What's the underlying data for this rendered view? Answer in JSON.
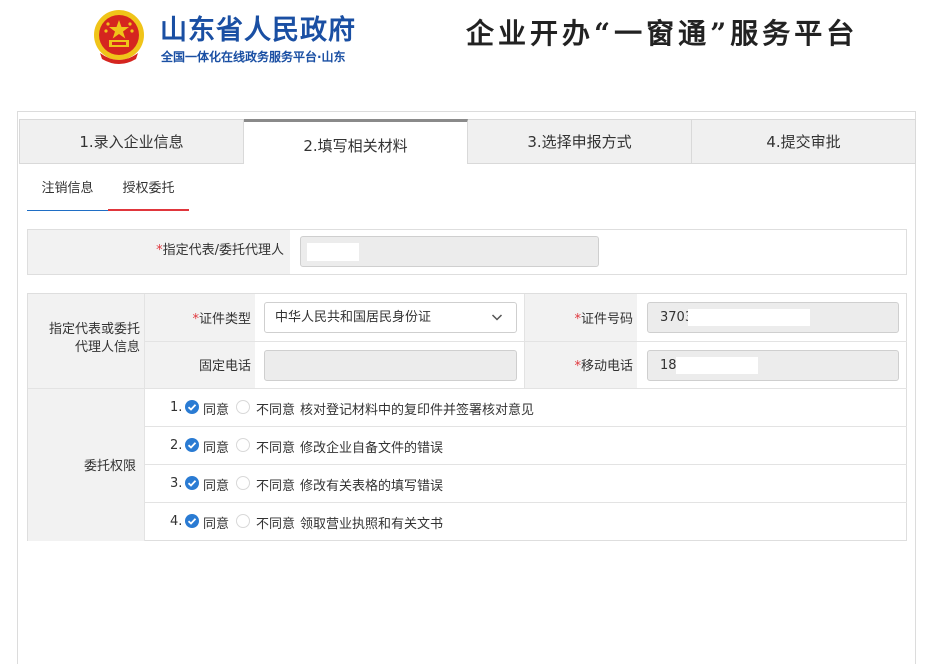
{
  "header": {
    "gov_name": "山东省人民政府",
    "gov_subtitle": "全国一体化在线政务服务平台·山东",
    "platform_title": "企业开办“一窗通”服务平台"
  },
  "steps": [
    {
      "label": "1.录入企业信息",
      "active": false
    },
    {
      "label": "2.填写相关材料",
      "active": true
    },
    {
      "label": "3.选择申报方式",
      "active": false
    },
    {
      "label": "4.提交审批",
      "active": false
    }
  ],
  "subtabs": {
    "first": "注销信息",
    "second": "授权委托"
  },
  "agent": {
    "required_mark": "*",
    "label": "指定代表/委托代理人",
    "value": ""
  },
  "agent_info": {
    "section_label": "指定代表或委托代理人信息",
    "id_type_label": "证件类型",
    "id_type_value": "中华人民共和国居民身份证",
    "id_number_label": "证件号码",
    "id_number_value": "3703",
    "landline_label": "固定电话",
    "landline_value": "",
    "mobile_label": "移动电话",
    "mobile_value": "18"
  },
  "permissions": {
    "section_label": "委托权限",
    "agree_label": "同意",
    "disagree_label": "不同意",
    "items": [
      {
        "num": "1.",
        "text": "核对登记材料中的复印件并签署核对意见",
        "selected": "agree"
      },
      {
        "num": "2.",
        "text": "修改企业自备文件的错误",
        "selected": "agree"
      },
      {
        "num": "3.",
        "text": "修改有关表格的填写错误",
        "selected": "agree"
      },
      {
        "num": "4.",
        "text": "领取营业执照和有关文书",
        "selected": "agree"
      }
    ]
  },
  "colors": {
    "brand_blue": "#1a4fa3",
    "accent_blue": "#2a7bd3",
    "accent_red": "#e0363c",
    "emblem_red": "#d5251f",
    "emblem_gold": "#f0c419"
  }
}
